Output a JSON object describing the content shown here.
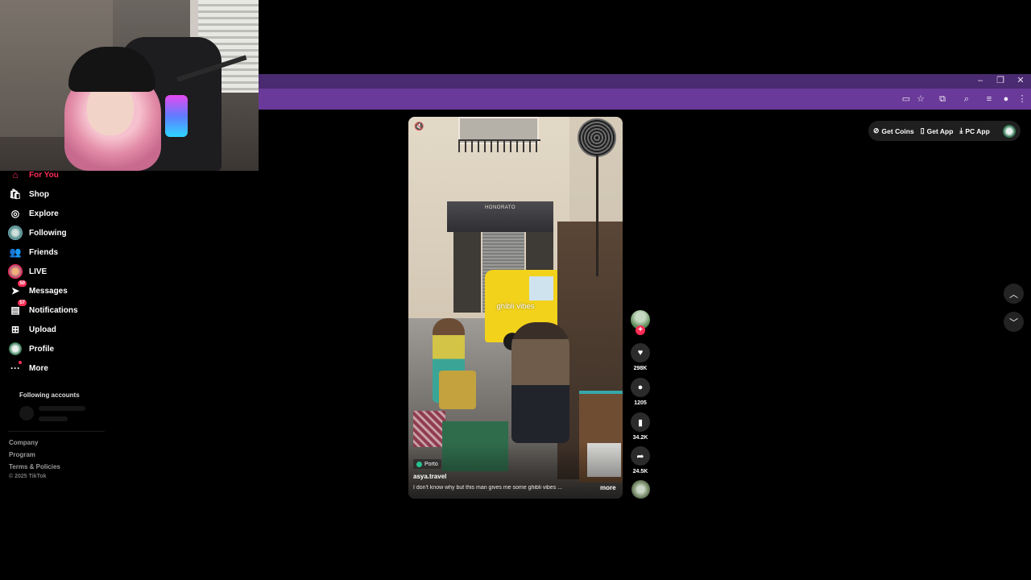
{
  "browser": {
    "window_controls": [
      "–",
      "❐",
      "✕"
    ],
    "toolbar_icons": [
      "cast-icon",
      "star-icon",
      "extensions-icon",
      "tab-search-icon",
      "media-icon",
      "profile-icon",
      "menu-icon"
    ]
  },
  "top_right": {
    "get_coins": "Get Coins",
    "get_app": "Get App",
    "pc_app": "PC App"
  },
  "sidebar": {
    "items": [
      {
        "label": "For You",
        "icon": "home-icon"
      },
      {
        "label": "Shop",
        "icon": "shop-icon"
      },
      {
        "label": "Explore",
        "icon": "compass-icon"
      },
      {
        "label": "Following",
        "icon": "avatar-icon"
      },
      {
        "label": "Friends",
        "icon": "friends-icon"
      },
      {
        "label": "LIVE",
        "icon": "live-icon"
      },
      {
        "label": "Messages",
        "icon": "messages-icon",
        "badge": "50"
      },
      {
        "label": "Notifications",
        "icon": "inbox-icon",
        "badge": "57"
      },
      {
        "label": "Upload",
        "icon": "upload-icon"
      },
      {
        "label": "Profile",
        "icon": "profile-avatar-icon"
      },
      {
        "label": "More",
        "icon": "more-icon"
      }
    ],
    "following_title": "Following accounts",
    "footer": [
      "Company",
      "Program",
      "Terms & Policies"
    ],
    "copyright": "© 2025 TikTok"
  },
  "video": {
    "sign_text": "HONORATO",
    "overlay_text": "ghibli vibes",
    "location": "Porto",
    "username": "asya.travel",
    "caption": "I don't know why but this man gives me some ghibli vibes ...",
    "more": "more"
  },
  "actions": {
    "likes": "298K",
    "comments": "1205",
    "saves": "34.2K",
    "shares": "24.5K",
    "follow_symbol": "+"
  },
  "colors": {
    "accent": "#fe2c55",
    "browser_frame": "#6a3a9a",
    "background": "#000000"
  }
}
